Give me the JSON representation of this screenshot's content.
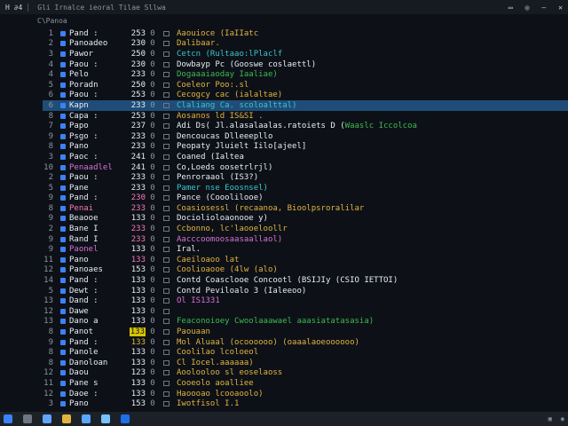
{
  "titlebar": {
    "left_text": "H  ∂4",
    "title": "Gli Irnalce  ieoral  Tilae  Sllwa",
    "controls": [
      "▭",
      "◎",
      "—",
      "✕"
    ]
  },
  "panel": {
    "header": "C\\Panoa"
  },
  "rows": [
    {
      "n": "1",
      "name": "Pand :",
      "name_color": "c-white",
      "size": "253",
      "size_color": "c-white",
      "desc": "Aaouioce  (IaIIatc",
      "desc_color": "c-yellow"
    },
    {
      "n": "2",
      "name": "Panoadeo",
      "name_color": "c-white",
      "size": "230",
      "size_color": "c-white",
      "desc": "Dalibaar.",
      "desc_color": "c-yellow"
    },
    {
      "n": "3",
      "name": "Pawor",
      "name_color": "c-white",
      "size": "250",
      "size_color": "c-white",
      "desc": "Cetcn  (Rultaao:lPlaclf",
      "desc_color": "c-cyan"
    },
    {
      "n": "4",
      "name": "Paou :",
      "name_color": "c-white",
      "size": "230",
      "size_color": "c-white",
      "desc": "Dowbayp Pc  (Gooswe  coslaettl)",
      "desc_color": "c-white"
    },
    {
      "n": "4",
      "name": "Pelo",
      "name_color": "c-white",
      "size": "233",
      "size_color": "c-white",
      "desc": "Dogaaaiaoday  Iaaliae)",
      "desc_color": "c-green"
    },
    {
      "n": "5",
      "name": "Poradn",
      "name_color": "c-white",
      "size": "250",
      "size_color": "c-white",
      "desc": "Coeleor  Poo:.sl",
      "desc_color": "c-yellow"
    },
    {
      "n": "6",
      "name": "Paou :",
      "name_color": "c-white",
      "size": "253",
      "size_color": "c-white",
      "desc": "Cecogcy  cac  (ialaltae)",
      "desc_color": "c-yellow"
    },
    {
      "n": "6",
      "name": "Kapn",
      "name_color": "c-white",
      "size": "233",
      "size_color": "c-white",
      "desc": "Claliang Ca.  scoloalttal)",
      "desc_color": "c-cyan",
      "selected": true
    },
    {
      "n": "8",
      "name": "Capa :",
      "name_color": "c-white",
      "size": "253",
      "size_color": "c-white",
      "desc": "Aosanos  ld  IS&SI .",
      "desc_color": "c-yellow"
    },
    {
      "n": "7",
      "name": "Papo",
      "name_color": "c-white",
      "size": "237",
      "size_color": "c-white",
      "desc": "Adi Ds( Jl.alasalaalas.ratoiets D (Waaslc  Iccolcoa",
      "desc_color": "c-white",
      "tail": "Waaslc  Iccolcoa",
      "tail_color": "c-green"
    },
    {
      "n": "9",
      "name": "Psgo :",
      "name_color": "c-white",
      "size": "233",
      "size_color": "c-white",
      "desc": "Dencoucas  Dlleeepllo",
      "desc_color": "c-white"
    },
    {
      "n": "8",
      "name": "Pano",
      "name_color": "c-white",
      "size": "233",
      "size_color": "c-white",
      "desc": "Peopaty  Jluielt  Iilo[ajeel]",
      "desc_color": "c-white"
    },
    {
      "n": "3",
      "name": "Paoc :",
      "name_color": "c-white",
      "size": "241",
      "size_color": "c-white",
      "desc": "Coaned  (Ialtea",
      "desc_color": "c-white"
    },
    {
      "n": "10",
      "name": "Penaadlel",
      "name_color": "c-magenta",
      "size": "241",
      "size_color": "c-white",
      "desc": "Co,Loeds  oosetrlrjl)",
      "desc_color": "c-white"
    },
    {
      "n": "2",
      "name": "Paou :",
      "name_color": "c-white",
      "size": "233",
      "size_color": "c-white",
      "desc": "Penroraaol  (IS3?)",
      "desc_color": "c-white"
    },
    {
      "n": "5",
      "name": "Pane",
      "name_color": "c-white",
      "size": "233",
      "size_color": "c-white",
      "desc": "Pamer nse  Eoosnsel)",
      "desc_color": "c-cyan"
    },
    {
      "n": "9",
      "name": "Pand :",
      "name_color": "c-white",
      "size": "230",
      "size_color": "c-pink",
      "desc": "Pance (Cooolilooe)",
      "desc_color": "c-white"
    },
    {
      "n": "8",
      "name": "Penai",
      "name_color": "c-pink",
      "size": "233",
      "size_color": "c-pink",
      "desc": "Coasiosessl  (recaanoa,  Bioolpsroralilar",
      "desc_color": "c-yellow"
    },
    {
      "n": "9",
      "name": "Beaooe",
      "name_color": "c-white",
      "size": "133",
      "size_color": "c-white",
      "desc": "Dociolioloaonooe y)",
      "desc_color": "c-white"
    },
    {
      "n": "2",
      "name": "Bane I",
      "name_color": "c-white",
      "size": "233",
      "size_color": "c-pink",
      "desc": "Ccbonno,  lc'laooeloollr",
      "desc_color": "c-yellow"
    },
    {
      "n": "9",
      "name": "Rand I",
      "name_color": "c-white",
      "size": "233",
      "size_color": "c-pink",
      "desc": "Aacccoomoosaasaallaol)",
      "desc_color": "c-magenta"
    },
    {
      "n": "9",
      "name": "Paonel",
      "name_color": "c-magenta",
      "size": "133",
      "size_color": "c-white",
      "desc": "Iral.",
      "desc_color": "c-white"
    },
    {
      "n": "11",
      "name": "Pano",
      "name_color": "c-white",
      "size": "133",
      "size_color": "c-pink",
      "desc": "Caeiloaoo  lat",
      "desc_color": "c-yellow"
    },
    {
      "n": "12",
      "name": "Panoaes",
      "name_color": "c-white",
      "size": "153",
      "size_color": "c-white",
      "desc": "Coolioaooe  (4lw  (alo)",
      "desc_color": "c-yellow"
    },
    {
      "n": "14",
      "name": "Pand :",
      "name_color": "c-white",
      "size": "133",
      "size_color": "c-white",
      "desc": "Contd   Coasclooe  Concootl  (BSIJIy  (CSIO  IETTOI)",
      "desc_color": "c-white"
    },
    {
      "n": "5",
      "name": "Dewt :",
      "name_color": "c-white",
      "size": "133",
      "size_color": "c-white",
      "desc": "Contd   Peviloalo 3  (Ialeeoo)",
      "desc_color": "c-white"
    },
    {
      "n": "13",
      "name": "Dand :",
      "name_color": "c-white",
      "size": "133",
      "size_color": "c-white",
      "desc": "Ol   IS1331",
      "desc_color": "c-magenta"
    },
    {
      "n": "12",
      "name": "Dawe",
      "name_color": "c-white",
      "size": "133",
      "size_color": "c-white",
      "desc": "",
      "desc_color": "c-white"
    },
    {
      "n": "13",
      "name": "Dano a",
      "name_color": "c-white",
      "size": "133",
      "size_color": "c-white",
      "desc": "Feaconoioey  Cwoolaaawael  aaasiatatasasia)",
      "desc_color": "c-green"
    },
    {
      "n": "8",
      "name": "Panot",
      "name_color": "c-white",
      "size": "133",
      "size_color": "c-white",
      "desc": "Paouaan",
      "desc_color": "c-yellow",
      "size_highlight": true
    },
    {
      "n": "9",
      "name": "Pand :",
      "name_color": "c-white",
      "size": "133",
      "size_color": "c-yellow",
      "desc": "Mol  Aluaal  (ocoooooo)  (oaaalaoeoooooo)",
      "desc_color": "c-yellow"
    },
    {
      "n": "8",
      "name": "Panole",
      "name_color": "c-white",
      "size": "133",
      "size_color": "c-white",
      "desc": "Coolilao  lcoloeol",
      "desc_color": "c-yellow"
    },
    {
      "n": "8",
      "name": "Danoloan",
      "name_color": "c-white",
      "size": "133",
      "size_color": "c-white",
      "desc": "Cl  Iocel.aaaaaa)",
      "desc_color": "c-yellow"
    },
    {
      "n": "12",
      "name": "Daou",
      "name_color": "c-white",
      "size": "123",
      "size_color": "c-white",
      "desc": "Aoolooloo  sl  eoselaoss",
      "desc_color": "c-yellow"
    },
    {
      "n": "11",
      "name": "Pane s",
      "name_color": "c-white",
      "size": "133",
      "size_color": "c-white",
      "desc": "Cooeolo  aoalliee",
      "desc_color": "c-yellow"
    },
    {
      "n": "12",
      "name": "Daoe :",
      "name_color": "c-white",
      "size": "133",
      "size_color": "c-white",
      "desc": "Haoooao  lcooaoolo)",
      "desc_color": "c-yellow"
    },
    {
      "n": "3",
      "name": "Pano",
      "name_color": "c-white",
      "size": "153",
      "size_color": "c-white",
      "desc": "Iwotfisol  I.1",
      "desc_color": "c-yellow"
    }
  ],
  "taskbar": {
    "tray_time": "",
    "icons": [
      "start-icon",
      "search-icon",
      "files-icon",
      "browser-icon",
      "terminal-icon",
      "editor-icon",
      "app-icon"
    ]
  },
  "colors": {
    "background": "#0d1117",
    "selection": "#1f4d78",
    "icon_blue": "#3b82f6"
  }
}
